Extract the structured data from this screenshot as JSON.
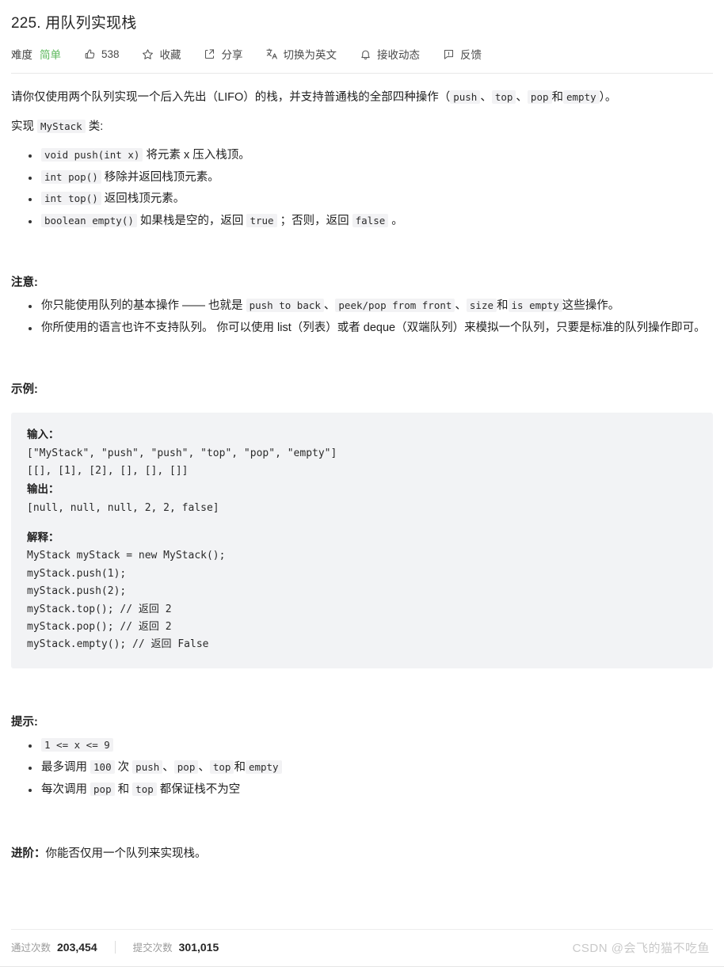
{
  "header": {
    "title": "225. 用队列实现栈",
    "difficulty_label": "难度",
    "difficulty_value": "简单",
    "difficulty_color": "#5cb85c",
    "actions": [
      {
        "icon": "thumbs-up-icon",
        "label": "538"
      },
      {
        "icon": "star-icon",
        "label": "收藏"
      },
      {
        "icon": "share-icon",
        "label": "分享"
      },
      {
        "icon": "translate-icon",
        "label": "切换为英文"
      },
      {
        "icon": "bell-icon",
        "label": "接收动态"
      },
      {
        "icon": "feedback-icon",
        "label": "反馈"
      }
    ]
  },
  "description": {
    "intro_part1": "请你仅使用两个队列实现一个后入先出（LIFO）的栈，并支持普通栈的全部四种操作（",
    "intro_code1": "push",
    "intro_sep1": "、",
    "intro_code2": "top",
    "intro_sep2": "、",
    "intro_code3": "pop",
    "intro_sep3": "和",
    "intro_code4": "empty",
    "intro_part2": "）。",
    "implement_prefix": "实现",
    "implement_code": "MyStack",
    "implement_suffix": "类:",
    "methods": [
      {
        "signature": "void push(int x)",
        "text": "将元素 x 压入栈顶。"
      },
      {
        "signature": "int pop()",
        "text": "移除并返回栈顶元素。"
      },
      {
        "signature": "int top()",
        "text": "返回栈顶元素。"
      },
      {
        "signature": "boolean empty()",
        "text_before": "如果栈是空的，返回",
        "code_true": "true",
        "text_middle": "；否则，返回",
        "code_false": "false",
        "text_after": "。"
      }
    ]
  },
  "notes": {
    "heading": "注意:",
    "item1_part1": "你只能使用队列的基本操作 —— 也就是",
    "item1_code1": "push to back",
    "item1_sep1": "、",
    "item1_code2": "peek/pop from front",
    "item1_sep2": "、",
    "item1_code3": "size",
    "item1_sep3": "和",
    "item1_code4": "is empty",
    "item1_part2": "这些操作。",
    "item2": "你所使用的语言也许不支持队列。 你可以使用 list（列表）或者 deque（双端队列）来模拟一个队列，只要是标准的队列操作即可。"
  },
  "example": {
    "heading": "示例:",
    "input_label": "输入：",
    "input_line1": "[\"MyStack\", \"push\", \"push\", \"top\", \"pop\", \"empty\"]",
    "input_line2": "[[], [1], [2], [], [], []]",
    "output_label": "输出：",
    "output_line": "[null, null, null, 2, 2, false]",
    "explain_label": "解释：",
    "explain_lines": [
      "MyStack myStack = new MyStack();",
      "myStack.push(1);",
      "myStack.push(2);",
      "myStack.top(); // 返回 2",
      "myStack.pop(); // 返回 2",
      "myStack.empty(); // 返回 False"
    ]
  },
  "hints": {
    "heading": "提示:",
    "item1_code": "1 <= x <= 9",
    "item2_part1": "最多调用",
    "item2_code_count": "100",
    "item2_part2": "次",
    "item2_code1": "push",
    "item2_sep1": "、",
    "item2_code2": "pop",
    "item2_sep2": "、",
    "item2_code3": "top",
    "item2_sep3": "和",
    "item2_code4": "empty",
    "item3_part1": "每次调用",
    "item3_code1": "pop",
    "item3_part2": "和",
    "item3_code2": "top",
    "item3_part3": "都保证栈不为空"
  },
  "advanced": {
    "label": "进阶：",
    "text": "你能否仅用一个队列来实现栈。"
  },
  "footer": {
    "accepted_label": "通过次数",
    "accepted_value": "203,454",
    "submissions_label": "提交次数",
    "submissions_value": "301,015",
    "watermark": "CSDN @会飞的猫不吃鱼"
  }
}
